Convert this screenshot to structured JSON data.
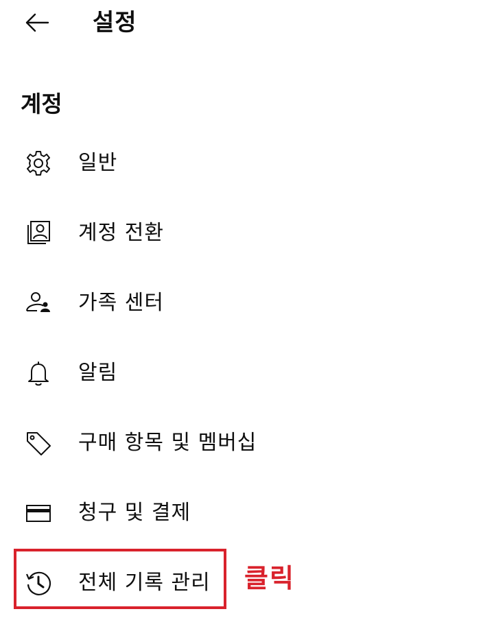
{
  "header": {
    "title": "설정",
    "back_icon": "arrow-left-icon"
  },
  "section": {
    "title": "계정"
  },
  "menu": {
    "items": [
      {
        "label": "일반",
        "icon": "gear-icon"
      },
      {
        "label": "계정 전환",
        "icon": "switch-account-icon"
      },
      {
        "label": "가족 센터",
        "icon": "family-center-icon"
      },
      {
        "label": "알림",
        "icon": "bell-icon"
      },
      {
        "label": "구매 항목 및 멤버십",
        "icon": "tag-icon"
      },
      {
        "label": "청구 및 결제",
        "icon": "credit-card-icon"
      },
      {
        "label": "전체 기록 관리",
        "icon": "history-icon"
      }
    ]
  },
  "annotation": {
    "text": "클릭",
    "color": "#d9222c"
  }
}
